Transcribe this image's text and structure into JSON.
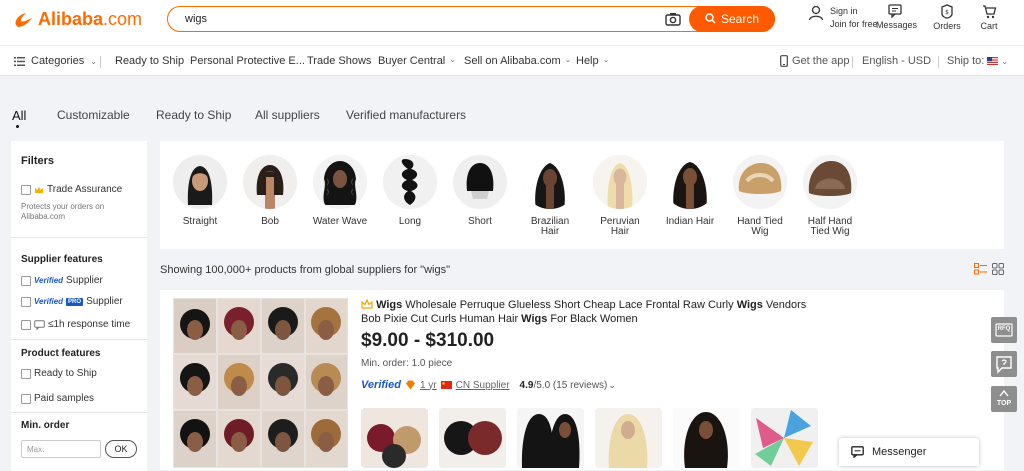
{
  "header": {
    "logo_text": "Alibaba",
    "logo_suffix": ".com",
    "search_value": "wigs",
    "search_button": "Search",
    "sign_in": "Sign in",
    "join_free": "Join for free",
    "messages": "Messages",
    "orders": "Orders",
    "cart": "Cart"
  },
  "nav": {
    "categories": "Categories",
    "items": [
      "Ready to Ship",
      "Personal Protective E...",
      "Trade Shows",
      "Buyer Central",
      "Sell on Alibaba.com",
      "Help"
    ],
    "get_app": "Get the app",
    "language": "English - USD",
    "ship_to": "Ship to:"
  },
  "tabs": [
    "All",
    "Customizable",
    "Ready to Ship",
    "All suppliers",
    "Verified manufacturers"
  ],
  "filters": {
    "title": "Filters",
    "trade_assurance": "Trade Assurance",
    "trade_note_1": "Protects your orders on",
    "trade_note_2": "Alibaba.com",
    "supplier_features": "Supplier features",
    "verified_word": "Verified",
    "supplier_word": "Supplier",
    "pro_badge": "PRO",
    "response_time": "≤1h response time",
    "product_features": "Product features",
    "ready_to_ship": "Ready to Ship",
    "paid_samples": "Paid samples",
    "min_order": "Min. order",
    "max_placeholder": "Max.",
    "ok": "OK"
  },
  "categories": [
    {
      "line1": "Straight",
      "line2": ""
    },
    {
      "line1": "Bob",
      "line2": ""
    },
    {
      "line1": "Water Wave",
      "line2": ""
    },
    {
      "line1": "Long",
      "line2": ""
    },
    {
      "line1": "Short",
      "line2": ""
    },
    {
      "line1": "Brazilian",
      "line2": "Hair"
    },
    {
      "line1": "Peruvian",
      "line2": "Hair"
    },
    {
      "line1": "Indian Hair",
      "line2": ""
    },
    {
      "line1": "Hand Tied",
      "line2": "Wig"
    },
    {
      "line1": "Half Hand",
      "line2": "Tied Wig"
    }
  ],
  "results_text": "Showing 100,000+ products from global suppliers for \"wigs\"",
  "product": {
    "title_1": "Wigs",
    "title_2": " Wholesale Perruque Glueless Short Cheap Lace Frontal Raw Curly ",
    "title_3": "Wigs",
    "title_4": " Vendors Bob Pixie Cut Curls Human Hair ",
    "title_5": "Wigs",
    "title_6": " For Black Women",
    "price": "$9.00 - $310.00",
    "min_order": "Min. order: 1.0 piece",
    "verified": "Verified",
    "years": "1 yr",
    "supplier": "CN Supplier",
    "rating": "4.9",
    "rating_suffix": "/5.0 (15 reviews)"
  },
  "side_tools": {
    "top": "TOP",
    "rfq": "RFQ"
  },
  "messenger": "Messenger",
  "colors": {
    "accent": "#ff6a00",
    "verified": "#1a57c4"
  }
}
